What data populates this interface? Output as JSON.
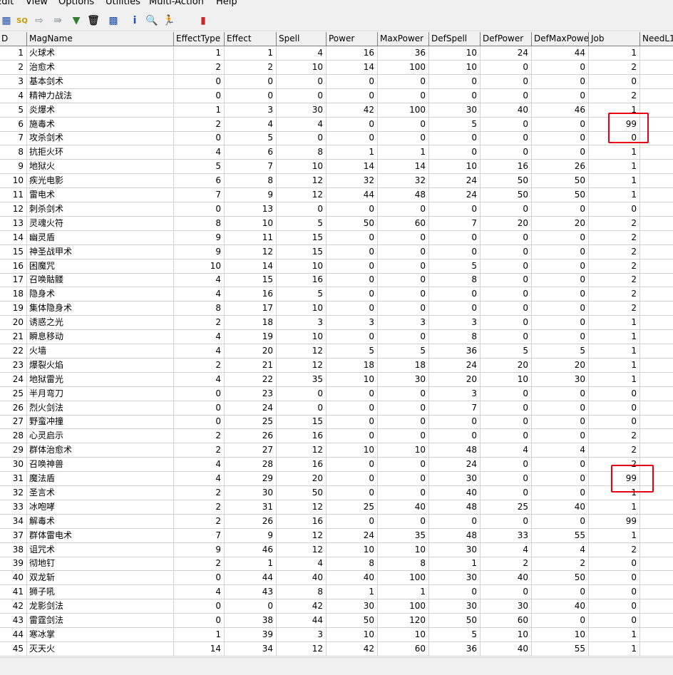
{
  "menu": [
    "Edit",
    "View",
    "Options",
    "Utilities",
    "Multi-Action",
    "Help"
  ],
  "toolbar": {
    "buttons": [
      {
        "name": "table-icon",
        "glyph": "▦",
        "color": "#1f4fa8"
      },
      {
        "name": "query-icon",
        "glyph": "SQ",
        "color": "#c79a00"
      },
      {
        "name": "forward-arrow-icon",
        "glyph": "⇨",
        "color": "#9aa0a6"
      },
      {
        "name": "export-icon",
        "glyph": "⇛",
        "color": "#9aa0a6"
      },
      {
        "name": "filter-icon",
        "glyph": "▼",
        "color": "#2e7d32"
      },
      {
        "name": "delete-icon",
        "glyph": "🗑",
        "color": "#222222"
      },
      {
        "name": "grid-icon",
        "glyph": "▩",
        "color": "#1f4fa8"
      },
      {
        "name": "info-icon",
        "glyph": "i",
        "color": "#1f4fa8"
      },
      {
        "name": "find-icon",
        "glyph": "🔍",
        "color": "#2e7d32"
      },
      {
        "name": "run-icon",
        "glyph": "🏃",
        "color": "#2e9d32"
      },
      {
        "name": "exit-icon",
        "glyph": "▮",
        "color": "#c62828"
      }
    ]
  },
  "grid": {
    "columns": [
      "D",
      "MagName",
      "EffectType",
      "Effect",
      "Spell",
      "Power",
      "MaxPower",
      "DefSpell",
      "DefPower",
      "DefMaxPower",
      "Job",
      "NeedL1"
    ],
    "rows": [
      [
        "1",
        "火球术",
        "1",
        "1",
        "4",
        "16",
        "36",
        "10",
        "24",
        "44",
        "1",
        ""
      ],
      [
        "2",
        "治愈术",
        "2",
        "2",
        "10",
        "14",
        "100",
        "10",
        "0",
        "0",
        "2",
        ""
      ],
      [
        "3",
        "基本剑术",
        "0",
        "0",
        "0",
        "0",
        "0",
        "0",
        "0",
        "0",
        "0",
        ""
      ],
      [
        "4",
        "精神力战法",
        "0",
        "0",
        "0",
        "0",
        "0",
        "0",
        "0",
        "0",
        "2",
        ""
      ],
      [
        "5",
        "炎爆术",
        "1",
        "3",
        "30",
        "42",
        "100",
        "30",
        "40",
        "46",
        "1",
        ""
      ],
      [
        "6",
        "施毒术",
        "2",
        "4",
        "4",
        "0",
        "0",
        "5",
        "0",
        "0",
        "99",
        ""
      ],
      [
        "7",
        "攻杀剑术",
        "0",
        "5",
        "0",
        "0",
        "0",
        "0",
        "0",
        "0",
        "0",
        ""
      ],
      [
        "8",
        "抗拒火环",
        "4",
        "6",
        "8",
        "1",
        "1",
        "0",
        "0",
        "0",
        "1",
        ""
      ],
      [
        "9",
        "地狱火",
        "5",
        "7",
        "10",
        "14",
        "14",
        "10",
        "16",
        "26",
        "1",
        ""
      ],
      [
        "10",
        "疾光电影",
        "6",
        "8",
        "12",
        "32",
        "32",
        "24",
        "50",
        "50",
        "1",
        ""
      ],
      [
        "11",
        "雷电术",
        "7",
        "9",
        "12",
        "44",
        "48",
        "24",
        "50",
        "50",
        "1",
        ""
      ],
      [
        "12",
        "刺杀剑术",
        "0",
        "13",
        "0",
        "0",
        "0",
        "0",
        "0",
        "0",
        "0",
        ""
      ],
      [
        "13",
        "灵魂火符",
        "8",
        "10",
        "5",
        "50",
        "60",
        "7",
        "20",
        "20",
        "2",
        ""
      ],
      [
        "14",
        "幽灵盾",
        "9",
        "11",
        "15",
        "0",
        "0",
        "0",
        "0",
        "0",
        "2",
        ""
      ],
      [
        "15",
        "神圣战甲术",
        "9",
        "12",
        "15",
        "0",
        "0",
        "0",
        "0",
        "0",
        "2",
        ""
      ],
      [
        "16",
        "困魔咒",
        "10",
        "14",
        "10",
        "0",
        "0",
        "5",
        "0",
        "0",
        "2",
        ""
      ],
      [
        "17",
        "召唤骷髅",
        "4",
        "15",
        "16",
        "0",
        "0",
        "8",
        "0",
        "0",
        "2",
        ""
      ],
      [
        "18",
        "隐身术",
        "4",
        "16",
        "5",
        "0",
        "0",
        "0",
        "0",
        "0",
        "2",
        ""
      ],
      [
        "19",
        "集体隐身术",
        "8",
        "17",
        "10",
        "0",
        "0",
        "0",
        "0",
        "0",
        "2",
        ""
      ],
      [
        "20",
        "诱惑之光",
        "2",
        "18",
        "3",
        "3",
        "3",
        "3",
        "0",
        "0",
        "1",
        ""
      ],
      [
        "21",
        "瞬息移动",
        "4",
        "19",
        "10",
        "0",
        "0",
        "8",
        "0",
        "0",
        "1",
        ""
      ],
      [
        "22",
        "火墙",
        "4",
        "20",
        "12",
        "5",
        "5",
        "36",
        "5",
        "5",
        "1",
        ""
      ],
      [
        "23",
        "爆裂火焰",
        "2",
        "21",
        "12",
        "18",
        "18",
        "24",
        "20",
        "20",
        "1",
        ""
      ],
      [
        "24",
        "地狱雷光",
        "4",
        "22",
        "35",
        "10",
        "30",
        "20",
        "10",
        "30",
        "1",
        ""
      ],
      [
        "25",
        "半月弯刀",
        "0",
        "23",
        "0",
        "0",
        "0",
        "3",
        "0",
        "0",
        "0",
        ""
      ],
      [
        "26",
        "烈火剑法",
        "0",
        "24",
        "0",
        "0",
        "0",
        "7",
        "0",
        "0",
        "0",
        ""
      ],
      [
        "27",
        "野蛮冲撞",
        "0",
        "25",
        "15",
        "0",
        "0",
        "0",
        "0",
        "0",
        "0",
        ""
      ],
      [
        "28",
        "心灵启示",
        "2",
        "26",
        "16",
        "0",
        "0",
        "0",
        "0",
        "0",
        "2",
        ""
      ],
      [
        "29",
        "群体治愈术",
        "2",
        "27",
        "12",
        "10",
        "10",
        "48",
        "4",
        "4",
        "2",
        ""
      ],
      [
        "30",
        "召唤神兽",
        "4",
        "28",
        "16",
        "0",
        "0",
        "24",
        "0",
        "0",
        "2",
        ""
      ],
      [
        "31",
        "魔法盾",
        "4",
        "29",
        "20",
        "0",
        "0",
        "30",
        "0",
        "0",
        "99",
        ""
      ],
      [
        "32",
        "圣言术",
        "2",
        "30",
        "50",
        "0",
        "0",
        "40",
        "0",
        "0",
        "1",
        ""
      ],
      [
        "33",
        "冰咆哮",
        "2",
        "31",
        "12",
        "25",
        "40",
        "48",
        "25",
        "40",
        "1",
        ""
      ],
      [
        "34",
        "解毒术",
        "2",
        "26",
        "16",
        "0",
        "0",
        "0",
        "0",
        "0",
        "99",
        ""
      ],
      [
        "37",
        "群体雷电术",
        "7",
        "9",
        "12",
        "24",
        "35",
        "48",
        "33",
        "55",
        "1",
        ""
      ],
      [
        "38",
        "诅咒术",
        "9",
        "46",
        "12",
        "10",
        "10",
        "30",
        "4",
        "4",
        "2",
        ""
      ],
      [
        "39",
        "彻地钉",
        "2",
        "1",
        "4",
        "8",
        "8",
        "1",
        "2",
        "2",
        "0",
        ""
      ],
      [
        "40",
        "双龙斩",
        "0",
        "44",
        "40",
        "40",
        "100",
        "30",
        "40",
        "50",
        "0",
        ""
      ],
      [
        "41",
        "狮子吼",
        "4",
        "43",
        "8",
        "1",
        "1",
        "0",
        "0",
        "0",
        "0",
        ""
      ],
      [
        "42",
        "龙影剑法",
        "0",
        "0",
        "42",
        "30",
        "100",
        "30",
        "30",
        "40",
        "0",
        ""
      ],
      [
        "43",
        "雷霆剑法",
        "0",
        "38",
        "44",
        "50",
        "120",
        "50",
        "60",
        "0",
        "0",
        ""
      ],
      [
        "44",
        "寒冰掌",
        "1",
        "39",
        "3",
        "10",
        "10",
        "5",
        "10",
        "10",
        "1",
        ""
      ],
      [
        "45",
        "灭天火",
        "14",
        "34",
        "12",
        "42",
        "60",
        "36",
        "40",
        "55",
        "1",
        ""
      ]
    ]
  },
  "colors": {
    "highlight": "#e60012"
  }
}
